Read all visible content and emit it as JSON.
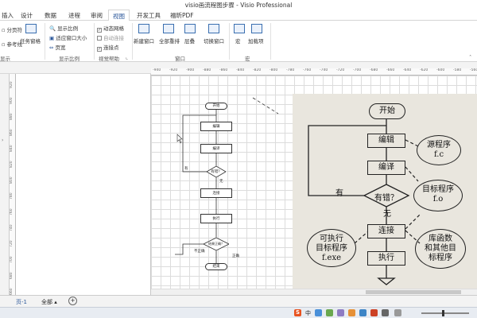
{
  "window": {
    "title": "visio画流程图步骤 - Visio Professional"
  },
  "tabs": [
    "插入",
    "设计",
    "数据",
    "进程",
    "审阅",
    "视图",
    "开发工具",
    "福昕PDF"
  ],
  "active_tab": "视图",
  "ribbon": {
    "split_screen": "分页符",
    "guides": "参考线",
    "task_pane": "任务窗格",
    "show_scale": "显示比例",
    "fit_window": "适应窗口大小",
    "page_width": "页宽",
    "dynamic_grid": "动态网格",
    "auto_connect": "自动连接",
    "connection_points": "连接点",
    "new_window": "新建窗口",
    "arrange_all": "全部重排",
    "cascade": "层叠",
    "switch_windows": "切换窗口",
    "macros": "宏",
    "addins": "加载项",
    "group_show": "显示",
    "group_zoom": "显示比例",
    "group_visual_aids": "视觉帮助",
    "group_window": "窗口",
    "group_macros": "宏"
  },
  "hruler_ticks": [
    "-940",
    "-920",
    "-900",
    "-880",
    "-860",
    "-840",
    "-820",
    "-800",
    "-780",
    "-760",
    "-740",
    "-720",
    "-700",
    "-680",
    "-660",
    "-640",
    "-620",
    "-600",
    "-580",
    "-560"
  ],
  "vruler_ticks": [
    "920",
    "900",
    "880",
    "860",
    "840",
    "820",
    "800",
    "780",
    "760",
    "740",
    "720",
    "700",
    "680",
    "660"
  ],
  "flowchart": {
    "start": "开始",
    "edit": "编辑",
    "compile": "编译",
    "error": "有错？",
    "link": "连接",
    "run": "执行",
    "result": "结果正确？",
    "end": "结束",
    "yes": "有",
    "no": "无",
    "incorrect": "不正确",
    "correct": "正确"
  },
  "photo": {
    "start": "开始",
    "edit": "编辑",
    "compile": "编译",
    "error": "有错？",
    "link": "连接",
    "run": "执行",
    "yes": "有",
    "no": "无",
    "source": "源程序",
    "source_ext": "f.c",
    "object": "目标程序",
    "object_ext": "f.o",
    "exec1": "可执行",
    "exec2": "目标程序",
    "exec_ext": "f.exe",
    "lib1": "库函数",
    "lib2": "和其他目",
    "lib3": "标程序"
  },
  "pagebar": {
    "page_tab": "页-1",
    "all": "全部 ▴",
    "add": "+"
  },
  "taskbar": {
    "ime": "S",
    "lang": "中"
  }
}
